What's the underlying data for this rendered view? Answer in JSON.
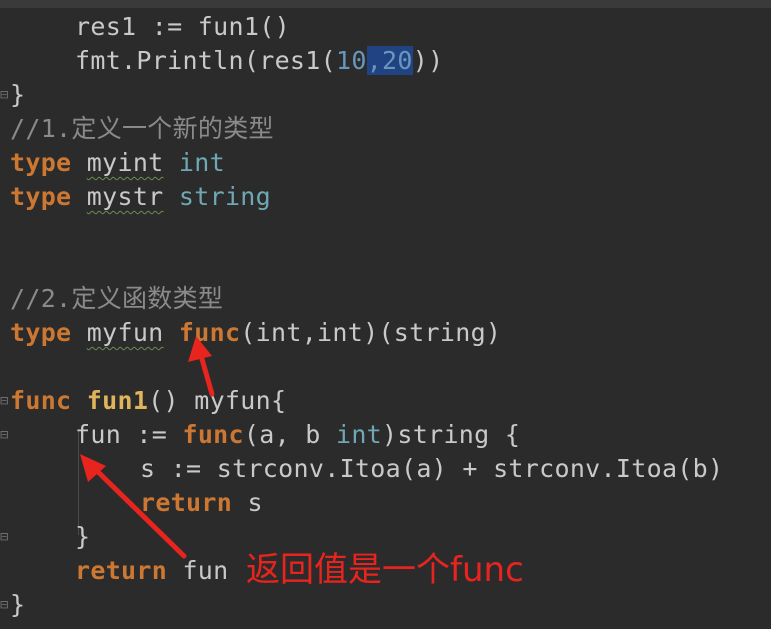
{
  "lines": [
    {
      "t1": "res1",
      "t2": " := fun1()"
    },
    {
      "t1": "fmt.Println(res1(",
      "n1": "10",
      "c": ",",
      "n2": "20",
      "t2": "))"
    },
    {
      "t1": "}"
    },
    {
      "t1": "//1.定义一个新的类型"
    },
    {
      "kw": "type",
      "name": "myint",
      "ty": "int"
    },
    {
      "kw": "type",
      "name": "mystr",
      "ty": "string"
    },
    {
      "t1": ""
    },
    {
      "t1": ""
    },
    {
      "t1": "//2.定义函数类型"
    },
    {
      "kw": "type",
      "name": "myfun",
      "kw2": "func",
      "rest": "(int,int)(string)"
    },
    {
      "t1": ""
    },
    {
      "kw": "func",
      "name": "fun1",
      "rest": "() myfun{"
    },
    {
      "pre": "fun := ",
      "kw": "func",
      "rest": "(a, b ",
      "ty": "int",
      "rest2": ")string {"
    },
    {
      "t1": "s := strconv.Itoa(a) + strconv.Itoa(b)"
    },
    {
      "kw": "return",
      "rest": " s"
    },
    {
      "t1": "}"
    },
    {
      "kw": "return",
      "rest": " fun"
    },
    {
      "t1": "}"
    }
  ],
  "annotation": {
    "text": "返回值是一个func",
    "color": "#e8241f"
  },
  "colors": {
    "background": "#2b2b2b",
    "keyword": "#cc7832",
    "comment": "#8a8a8a",
    "number": "#6897bb",
    "type": "#6fa8b5",
    "selection": "#214283"
  }
}
